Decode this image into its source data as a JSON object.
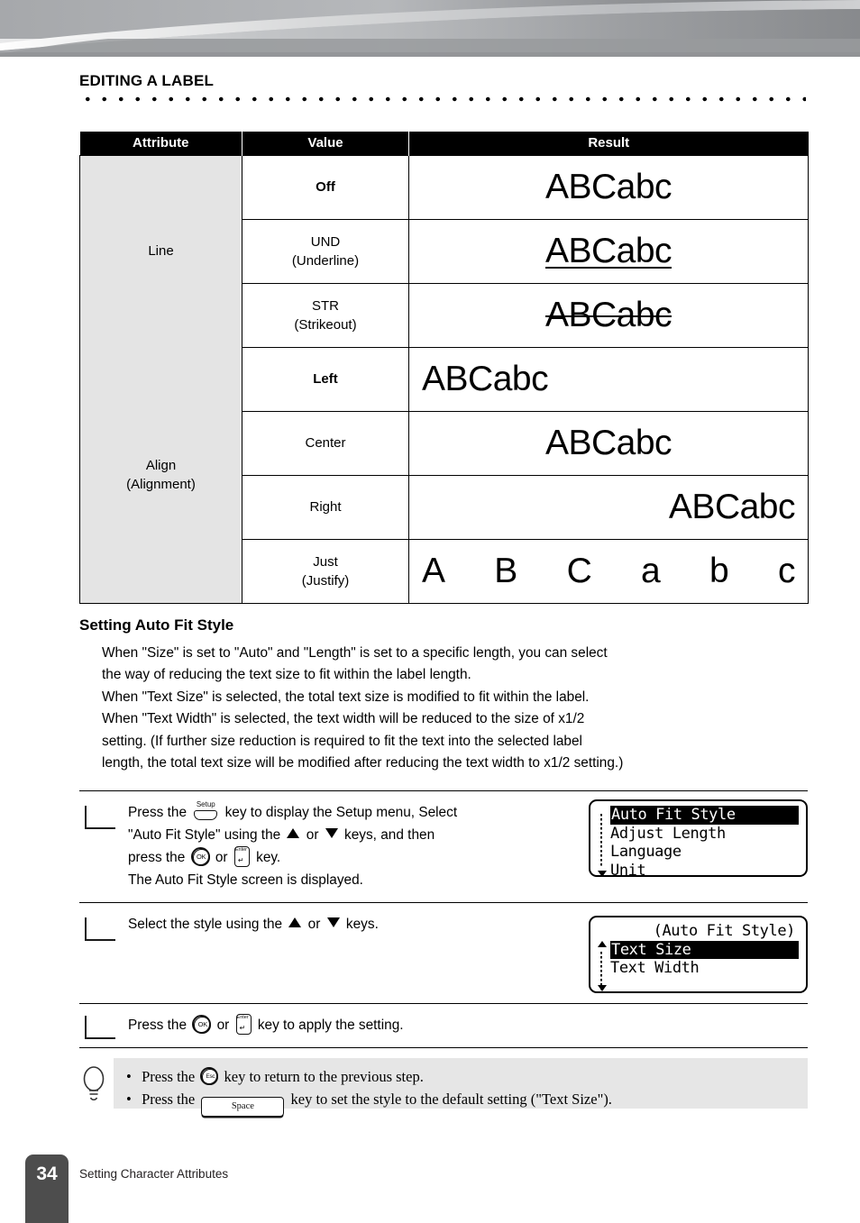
{
  "chapter": {
    "title": "EDITING A LABEL"
  },
  "table": {
    "headers": {
      "attribute": "Attribute",
      "value": "Value",
      "result": "Result"
    },
    "groups": [
      {
        "attribute": "Line",
        "rows": [
          {
            "value": "Off",
            "value_bold": true,
            "sample": "ABCabc",
            "style": "none",
            "align": "center"
          },
          {
            "value": "UND",
            "value_sub": "(Underline)",
            "value_bold": false,
            "sample": "ABCabc",
            "style": "underline",
            "align": "center"
          },
          {
            "value": "STR",
            "value_sub": "(Strikeout)",
            "value_bold": false,
            "sample": "ABCabc",
            "style": "strikeout",
            "align": "center"
          }
        ]
      },
      {
        "attribute": "Align",
        "attribute_sub": "(Alignment)",
        "rows": [
          {
            "value": "Left",
            "value_bold": true,
            "sample": "ABCabc",
            "style": "none",
            "align": "left"
          },
          {
            "value": "Center",
            "value_bold": false,
            "sample": "ABCabc",
            "style": "none",
            "align": "center"
          },
          {
            "value": "Right",
            "value_bold": false,
            "sample": "ABCabc",
            "style": "none",
            "align": "right"
          },
          {
            "value": "Just",
            "value_sub": "(Justify)",
            "value_bold": false,
            "sample_chars": [
              "A",
              "B",
              "C",
              "a",
              "b",
              "c"
            ],
            "style": "none",
            "align": "justify"
          }
        ]
      }
    ]
  },
  "section": {
    "heading": "Setting Auto Fit Style",
    "paragraph_lines": [
      "When \"Size\" is set to \"Auto\" and \"Length\" is set to a specific length, you can select",
      "the way of reducing the text size to fit within the label length.",
      "When \"Text Size\" is selected, the total text size is modified to fit within the label.",
      "When \"Text Width\" is selected, the text width will be reduced to the size of x1/2",
      "setting. (If further size reduction is required to fit the text into the selected label",
      "length, the total text size will be modified after reducing the text width to x1/2 setting.)"
    ]
  },
  "steps": [
    {
      "text_parts": {
        "p1": "Press the",
        "p2": "key to display the Setup menu, Select",
        "p3": "\"Auto Fit Style\" using the",
        "p4": "or",
        "p5": "keys, and then",
        "p6": "press the",
        "p7": "or",
        "p8": "key.",
        "p9": "The Auto Fit Style screen is displayed."
      },
      "keys": {
        "setup": "Setup",
        "ok": "OK",
        "enter": "Enter"
      },
      "lcd": {
        "title": null,
        "lines": [
          {
            "text": "Auto Fit Style",
            "selected": true
          },
          {
            "text": "Adjust Length",
            "selected": false
          },
          {
            "text": "Language",
            "selected": false
          },
          {
            "text": "Unit",
            "selected": false
          }
        ],
        "scroll": {
          "up": false,
          "down": true
        }
      }
    },
    {
      "text_parts": {
        "p1": "Select the style using the",
        "p2": "or",
        "p3": "keys."
      },
      "lcd": {
        "title": "(Auto Fit Style)",
        "lines": [
          {
            "text": "Text Size",
            "selected": true
          },
          {
            "text": "Text Width",
            "selected": false
          }
        ],
        "scroll": {
          "up": true,
          "down": true
        }
      }
    },
    {
      "text_parts": {
        "p1": "Press the",
        "p2": "or",
        "p3": "key to apply the setting."
      },
      "keys": {
        "ok": "OK",
        "enter": "Enter"
      }
    }
  ],
  "tip": {
    "items": [
      {
        "pre": "Press the",
        "key": "Esc",
        "post": "key to return to the previous step."
      },
      {
        "pre": "Press the",
        "key": "Space",
        "post": "key to set the style to the default setting (\"Text Size\")."
      }
    ]
  },
  "footer": {
    "page_number": "34",
    "text": "Setting Character Attributes"
  },
  "colors": {
    "header_bg": "#000000",
    "attr_cell_bg": "#e4e4e4",
    "tip_bg": "#e6e6e6",
    "footer_tab": "#4d4d4d"
  }
}
